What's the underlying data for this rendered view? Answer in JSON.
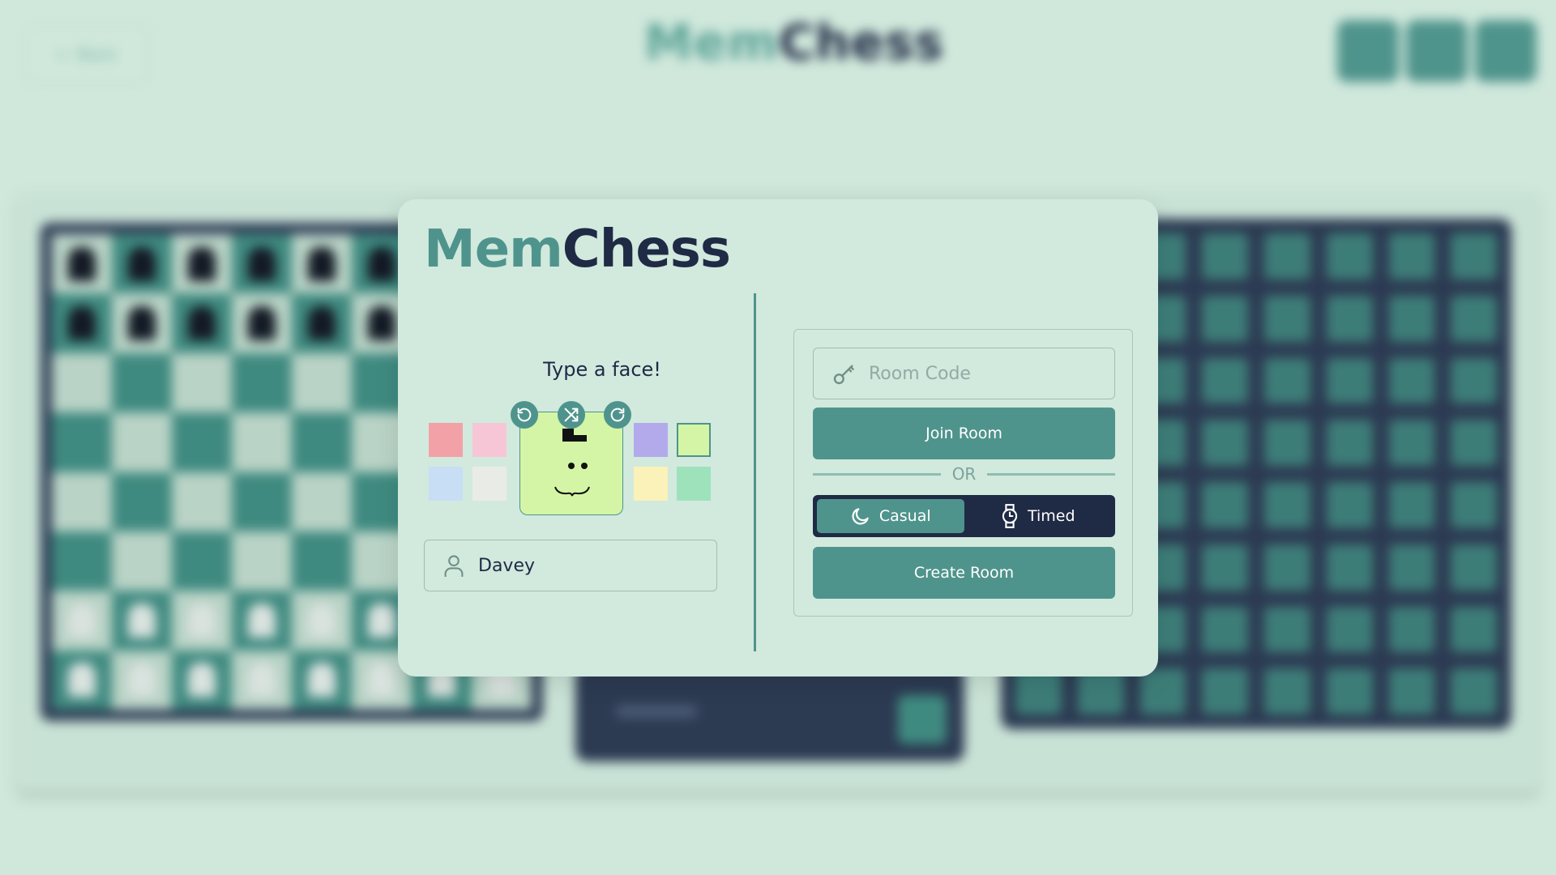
{
  "background": {
    "back_label": "Back",
    "title_mem": "Mem",
    "title_chess": "Chess"
  },
  "modal": {
    "logo_mem": "Mem",
    "logo_chess": "Chess",
    "face_prompt": "Type a face!",
    "swatches_left": [
      "#f2a1a7",
      "#f7c6d6",
      "#c8def5",
      "#e9ece6"
    ],
    "swatches_right": [
      "#b3aaec",
      "#d3f5a5",
      "#faf2b8",
      "#9ee2bb"
    ],
    "selected_color": "#d3f5a5",
    "username": "Davey",
    "room_code_placeholder": "Room Code",
    "join_label": "Join Room",
    "or_label": "OR",
    "modes": [
      "Casual",
      "Timed"
    ],
    "active_mode": "Casual",
    "create_label": "Create Room"
  },
  "colors": {
    "accent": "#4f948c",
    "dark": "#1f2a44",
    "background": "#d0e8dc"
  }
}
